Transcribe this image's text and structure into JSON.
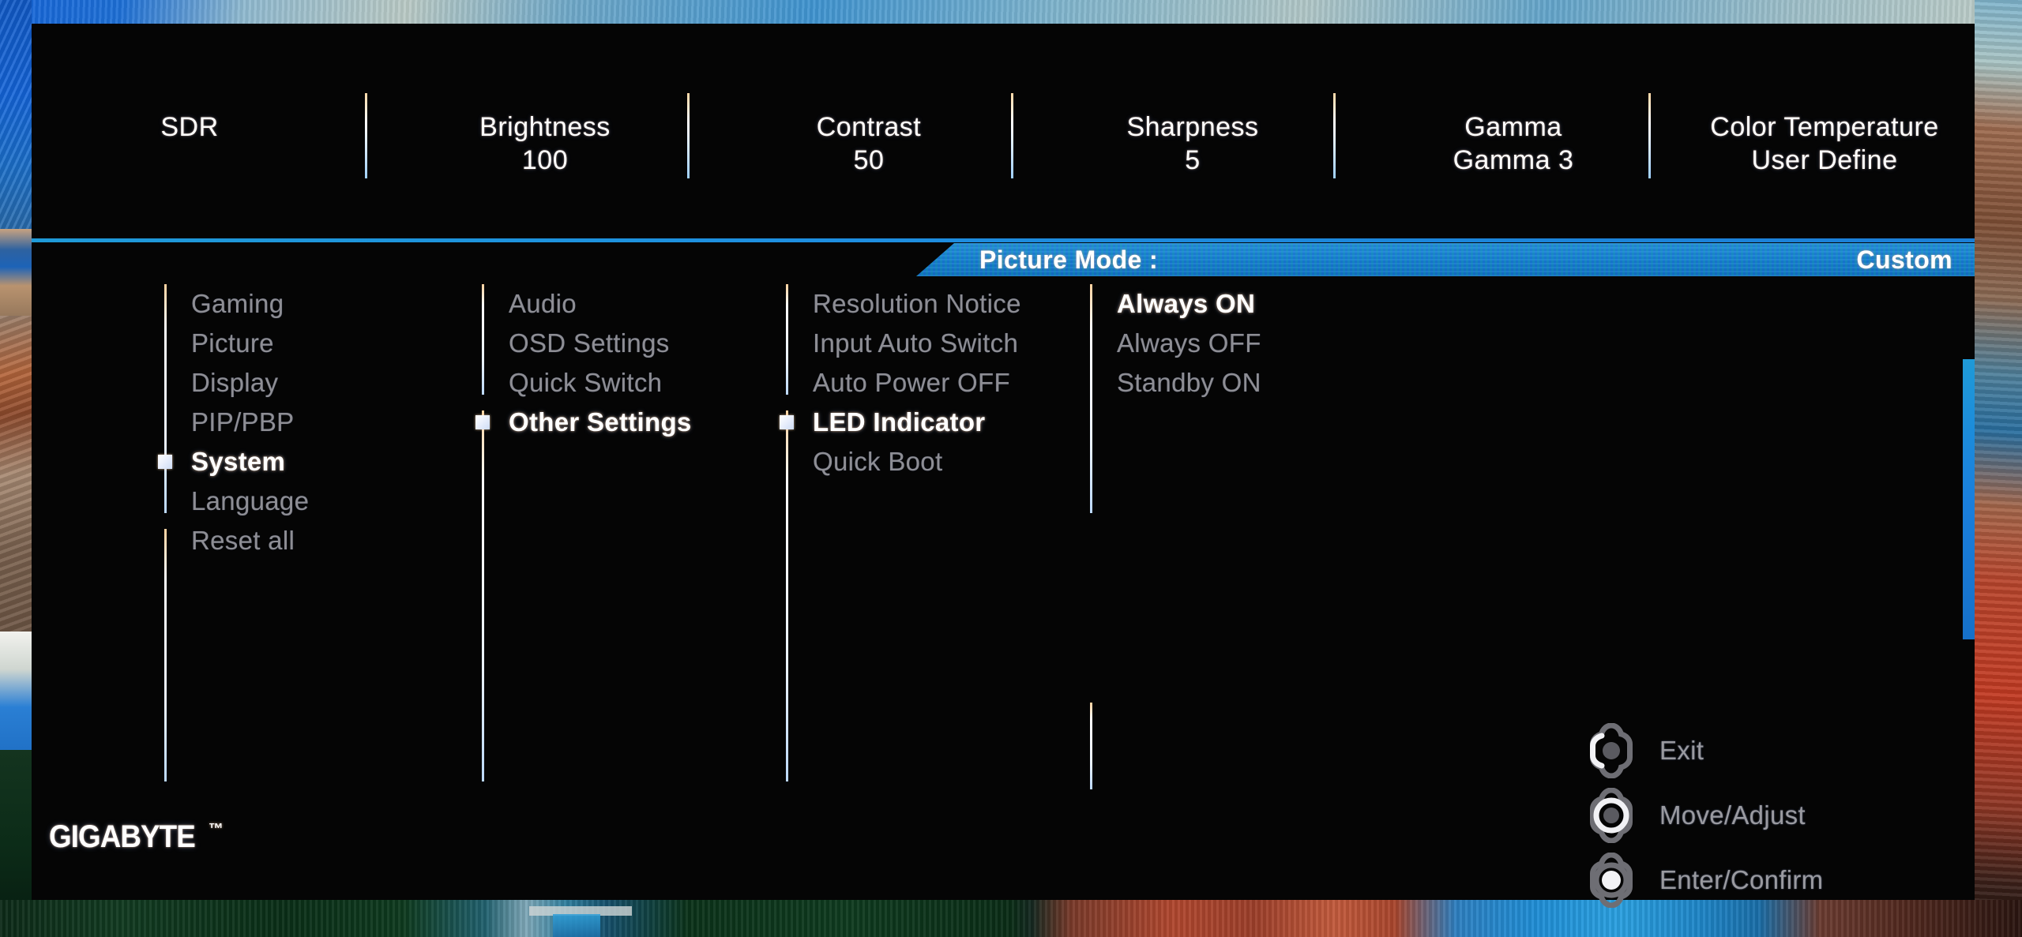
{
  "header": {
    "items": [
      {
        "label": "SDR",
        "value": ""
      },
      {
        "label": "Brightness",
        "value": "100"
      },
      {
        "label": "Contrast",
        "value": "50"
      },
      {
        "label": "Sharpness",
        "value": "5"
      },
      {
        "label": "Gamma",
        "value": "Gamma 3"
      },
      {
        "label": "Color Temperature",
        "value": "User Define"
      }
    ]
  },
  "picture_mode": {
    "label": "Picture Mode  :",
    "value": "Custom"
  },
  "menu": {
    "column1": [
      {
        "label": "Gaming",
        "selected": false
      },
      {
        "label": "Picture",
        "selected": false
      },
      {
        "label": "Display",
        "selected": false
      },
      {
        "label": "PIP/PBP",
        "selected": false
      },
      {
        "label": "System",
        "selected": true
      },
      {
        "label": "Language",
        "selected": false
      },
      {
        "label": "Reset all",
        "selected": false
      }
    ],
    "column2": [
      {
        "label": "Audio",
        "selected": false
      },
      {
        "label": "OSD Settings",
        "selected": false
      },
      {
        "label": "Quick Switch",
        "selected": false
      },
      {
        "label": "Other Settings",
        "selected": true
      }
    ],
    "column3": [
      {
        "label": "Resolution Notice",
        "selected": false
      },
      {
        "label": "Input Auto Switch",
        "selected": false
      },
      {
        "label": "Auto Power OFF",
        "selected": false
      },
      {
        "label": "LED Indicator",
        "selected": true
      },
      {
        "label": "Quick Boot",
        "selected": false
      }
    ],
    "column4": [
      {
        "label": "Always ON",
        "selected": true
      },
      {
        "label": "Always OFF",
        "selected": false
      },
      {
        "label": "Standby ON",
        "selected": false
      }
    ]
  },
  "hints": [
    {
      "label": "Exit",
      "icon": "joystick-left-icon"
    },
    {
      "label": "Move/Adjust",
      "icon": "joystick-move-icon"
    },
    {
      "label": "Enter/Confirm",
      "icon": "joystick-press-icon"
    }
  ],
  "logo": {
    "word": "GIGABYTE",
    "tm": "™"
  },
  "colors": {
    "accent_blue": "#1b7fd8",
    "panel_black": "#050505",
    "text_dim": "#8e8e94",
    "text_active": "#ffffff"
  }
}
